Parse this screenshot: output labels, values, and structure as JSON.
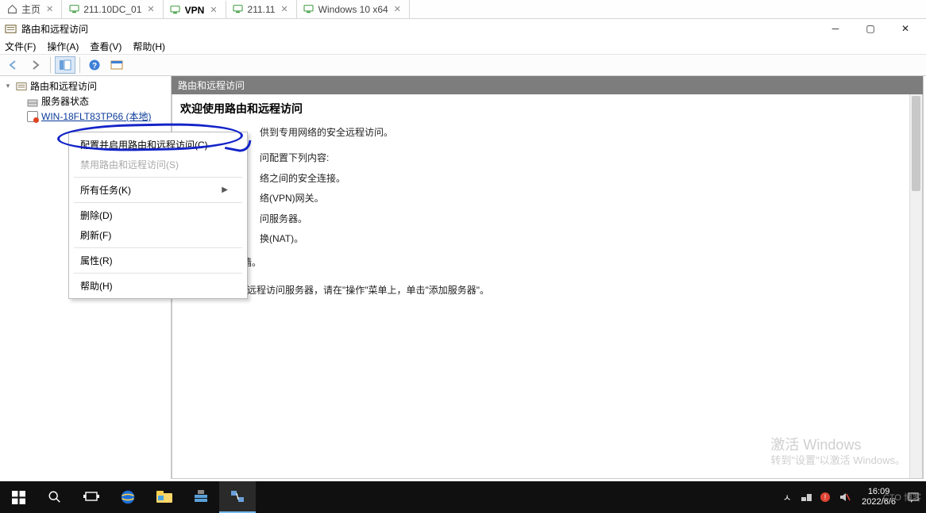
{
  "vmtabs": [
    {
      "label": "主页",
      "icon": "home"
    },
    {
      "label": "211.10DC_01",
      "icon": "monitor"
    },
    {
      "label": "VPN",
      "icon": "monitor",
      "active": true
    },
    {
      "label": "211.11",
      "icon": "monitor"
    },
    {
      "label": "Windows 10 x64",
      "icon": "monitor"
    }
  ],
  "window": {
    "title": "路由和远程访问",
    "menus": [
      "文件(F)",
      "操作(A)",
      "查看(V)",
      "帮助(H)"
    ]
  },
  "tree": {
    "root": "路由和远程访问",
    "status": "服务器状态",
    "server": "WIN-18FLT83TP66 (本地)"
  },
  "context_menu": {
    "configure": "配置并启用路由和远程访问(C)",
    "disable": "禁用路由和远程访问(S)",
    "all_tasks": "所有任务(K)",
    "delete": "删除(D)",
    "refresh": "刷新(F)",
    "properties": "属性(R)",
    "help": "帮助(H)"
  },
  "content": {
    "header": "路由和远程访问",
    "title": "欢迎使用路由和远程访问",
    "line1": "供到专用网络的安全远程访问。",
    "line2": "问配置下列内容:",
    "b1": "络之间的安全连接。",
    "b2": "络(VPN)网关。",
    "b3": "问服务器。",
    "b4": "换(NAT)。",
    "fw": "#149 基本防火墙。",
    "tip": "若要添加路由和远程访问服务器，请在\"操作\"菜单上，单击\"添加服务器\"。"
  },
  "watermark": {
    "l1": "激活 Windows",
    "l2": "转到\"设置\"以激活 Windows。"
  },
  "tray": {
    "caret": "ㅅ",
    "time": "16:09",
    "date": "2022/6/6",
    "tag": "CTO 博客"
  }
}
